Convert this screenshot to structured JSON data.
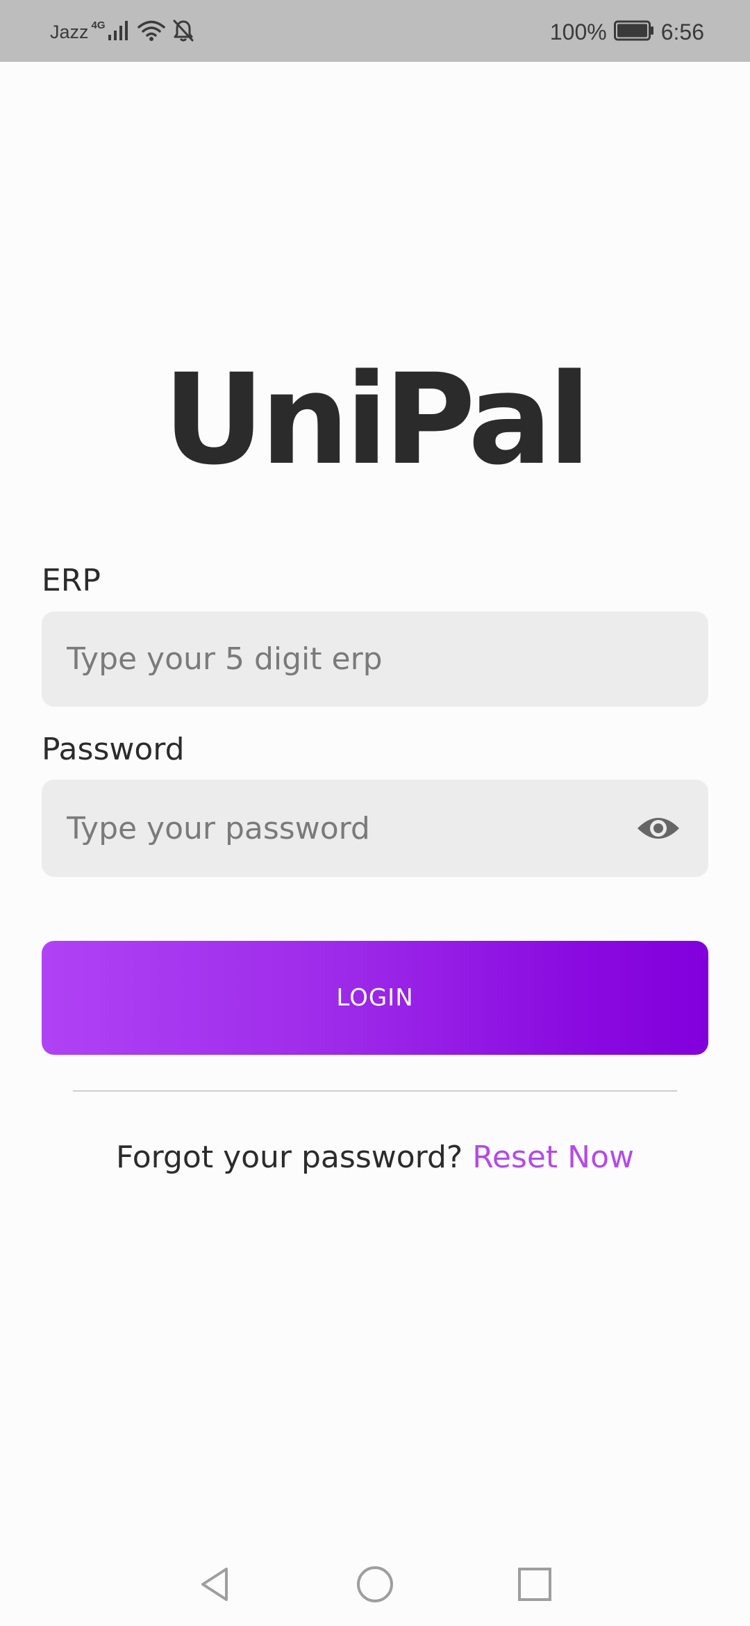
{
  "status_bar": {
    "carrier": "Jazz",
    "network_type": "4G",
    "battery_percent": "100%",
    "time": "6:56",
    "icons": [
      "signal-icon",
      "wifi-icon",
      "bell-muted-icon",
      "battery-icon"
    ]
  },
  "app": {
    "title": "UniPal"
  },
  "form": {
    "erp_label": "ERP",
    "erp_placeholder": "Type your 5 digit erp",
    "erp_value": "",
    "password_label": "Password",
    "password_placeholder": "Type your password",
    "password_value": "",
    "login_label": "LOGIN"
  },
  "footer": {
    "forgot_text": "Forgot your password?",
    "reset_link": "Reset Now"
  },
  "nav_bar": {
    "icons": [
      "back-icon",
      "home-icon",
      "recents-icon"
    ]
  },
  "colors": {
    "accent": "#b34ae8",
    "button_gradient_start": "#b042f5",
    "button_gradient_end": "#8200dc",
    "input_bg": "#ececec",
    "status_bar_bg": "#bdbdbd"
  }
}
